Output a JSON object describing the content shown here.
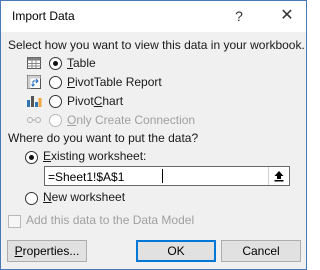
{
  "window": {
    "title": "Import Data",
    "help_glyph": "?",
    "close_glyph": "✕"
  },
  "view_section": {
    "prompt": "Select how you want to view this data in your workbook.",
    "options": [
      {
        "label": "Table",
        "selected": true,
        "enabled": true,
        "icon": "table-icon"
      },
      {
        "label": "PivotTable Report",
        "selected": false,
        "enabled": true,
        "icon": "pivottable-icon"
      },
      {
        "label": "PivotChart",
        "selected": false,
        "enabled": true,
        "icon": "pivotchart-icon"
      },
      {
        "label": "Only Create Connection",
        "selected": false,
        "enabled": false,
        "icon": "connection-icon"
      }
    ]
  },
  "location_section": {
    "prompt": "Where do you want to put the data?",
    "existing_label": "Existing worksheet:",
    "existing_selected": true,
    "range_value": "=Sheet1!$A$1",
    "new_label": "New worksheet",
    "new_selected": false
  },
  "data_model": {
    "label": "Add this data to the Data Model",
    "checked": false,
    "enabled": false
  },
  "buttons": {
    "properties": "Properties...",
    "ok": "OK",
    "cancel": "Cancel"
  }
}
